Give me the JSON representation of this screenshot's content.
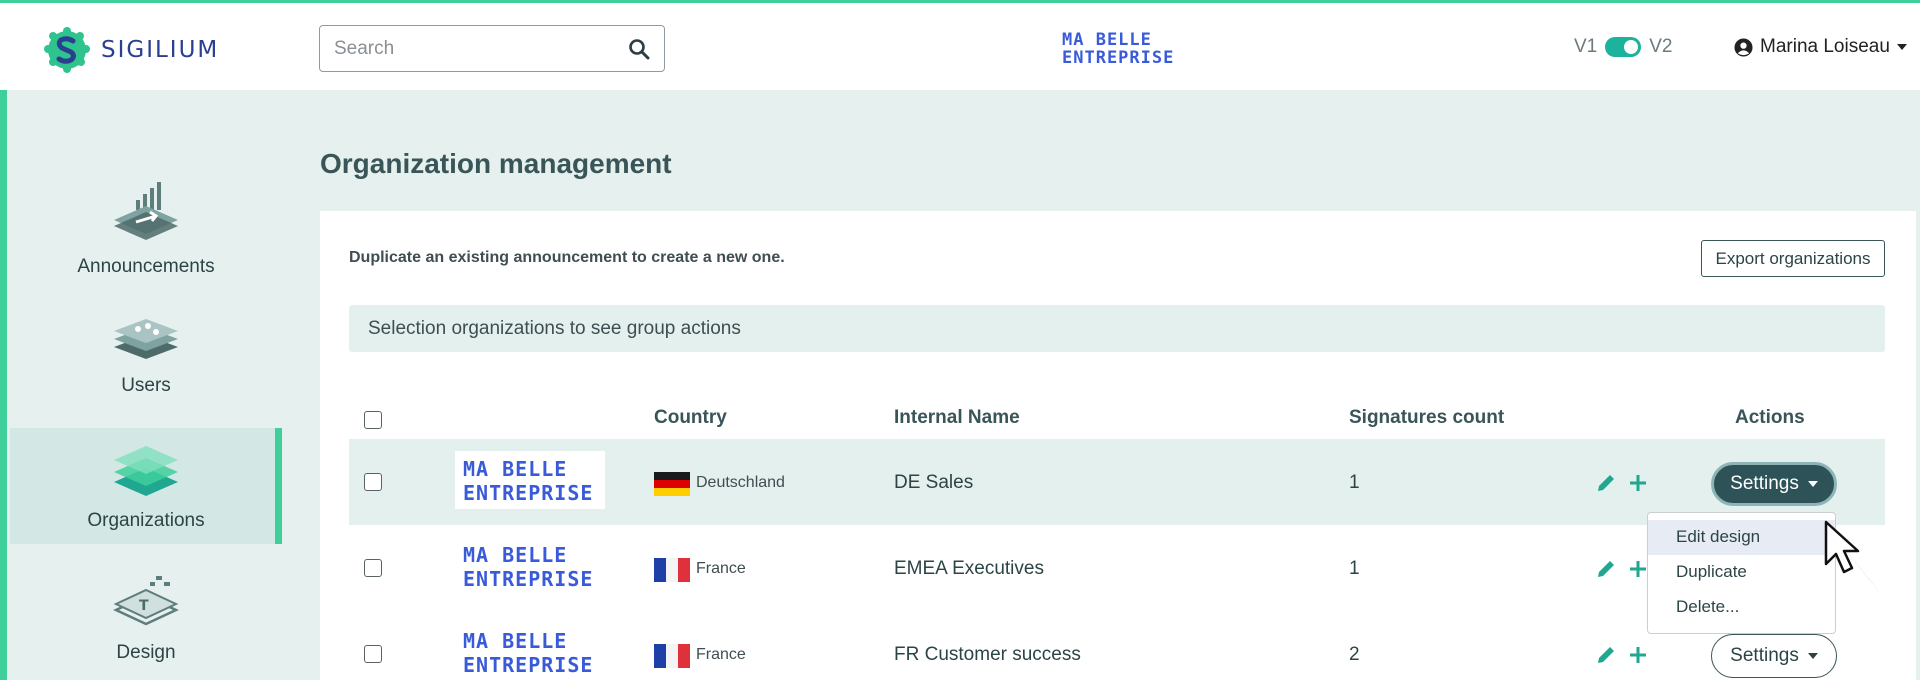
{
  "header": {
    "brand": "SIGILIUM",
    "search": {
      "placeholder": "Search",
      "value": ""
    },
    "company_logo_line1": "MA BELLE",
    "company_logo_line2": "ENTREPRISE",
    "version_left": "V1",
    "version_right": "V2",
    "version_toggle_on": true,
    "user_name": "Marina Loiseau"
  },
  "sidebar": {
    "items": [
      {
        "label": "Announcements",
        "icon": "announcement-icon",
        "active": false
      },
      {
        "label": "Users",
        "icon": "users-icon",
        "active": false
      },
      {
        "label": "Organizations",
        "icon": "organizations-icon",
        "active": true
      },
      {
        "label": "Design",
        "icon": "design-icon",
        "active": false
      }
    ]
  },
  "main": {
    "title": "Organization management",
    "hint": "Duplicate an existing announcement to create a new one.",
    "export_label": "Export organizations",
    "group_actions_text": "Selection organizations to see group actions",
    "columns": [
      "Country",
      "Internal Name",
      "Signatures count",
      "Actions"
    ],
    "rows": [
      {
        "logo_line1": "MA BELLE",
        "logo_line2": "ENTREPRISE",
        "country": "Deutschland",
        "flag": "germany-flag",
        "internal_name": "DE Sales",
        "signatures": "1",
        "settings_label": "Settings"
      },
      {
        "logo_line1": "MA BELLE",
        "logo_line2": "ENTREPRISE",
        "country": "France",
        "flag": "france-flag",
        "internal_name": "EMEA Executives",
        "signatures": "1",
        "settings_label": "Settings"
      },
      {
        "logo_line1": "MA BELLE",
        "logo_line2": "ENTREPRISE",
        "country": "France",
        "flag": "france-flag",
        "internal_name": "FR Customer success",
        "signatures": "2",
        "settings_label": "Settings"
      }
    ],
    "settings_menu": [
      "Edit design",
      "Duplicate",
      "Delete..."
    ]
  },
  "colors": {
    "accent": "#3ecf9b",
    "teal_dark": "#2d5358",
    "logo_blue": "#3a5bd9",
    "background": "#e6f1ef"
  }
}
